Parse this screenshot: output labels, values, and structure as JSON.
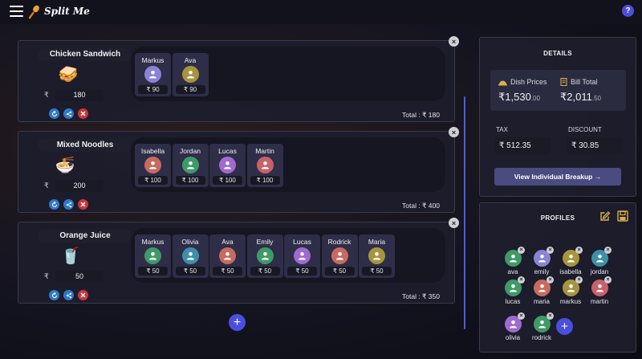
{
  "app": {
    "title": "Split Me",
    "help_label": "?"
  },
  "currency": "₹",
  "dishes": [
    {
      "name": "Chicken Sandwich",
      "emoji": "🥪",
      "price": "180",
      "total": "Total :  ₹ 180",
      "shares": [
        {
          "name": "Markus",
          "amount": "₹ 90",
          "color": "#8a83d6"
        },
        {
          "name": "Ava",
          "amount": "₹ 90",
          "color": "#a8943f"
        }
      ]
    },
    {
      "name": "Mixed Noodles",
      "emoji": "🍜",
      "price": "200",
      "total": "Total :  ₹ 400",
      "shares": [
        {
          "name": "Isabella",
          "amount": "₹ 100",
          "color": "#c86a5e"
        },
        {
          "name": "Jordan",
          "amount": "₹ 100",
          "color": "#3f9a66"
        },
        {
          "name": "Lucas",
          "amount": "₹ 100",
          "color": "#a06ad0"
        },
        {
          "name": "Martin",
          "amount": "₹ 100",
          "color": "#c8606a"
        }
      ]
    },
    {
      "name": "Orange Juice",
      "emoji": "🥤",
      "price": "50",
      "total": "Total :  ₹ 350",
      "shares": [
        {
          "name": "Markus",
          "amount": "₹ 50",
          "color": "#3f9a66"
        },
        {
          "name": "Olivia",
          "amount": "₹ 50",
          "color": "#3e8fa8"
        },
        {
          "name": "Ava",
          "amount": "₹ 50",
          "color": "#c86a5e"
        },
        {
          "name": "Emily",
          "amount": "₹ 50",
          "color": "#3f9a66"
        },
        {
          "name": "Lucas",
          "amount": "₹ 50",
          "color": "#a06ad0"
        },
        {
          "name": "Rodrick",
          "amount": "₹ 50",
          "color": "#c86a5e"
        },
        {
          "name": "Maria",
          "amount": "₹ 50",
          "color": "#a8943f"
        }
      ]
    }
  ],
  "details": {
    "title": "DETAILS",
    "dish_prices_label": "Dish Prices",
    "dish_prices_main": "₹1,530",
    "dish_prices_dec": ".00",
    "bill_total_label": "Bill Total",
    "bill_total_main": "₹2,011",
    "bill_total_dec": ".50",
    "tax_label": "TAX",
    "tax_value": "₹ 512.35",
    "discount_label": "DISCOUNT",
    "discount_value": "₹ 30.85",
    "breakup_label": "View Individual Breakup  →"
  },
  "profiles": {
    "title": "PROFILES",
    "list": [
      {
        "name": "ava",
        "color": "#3f9a66"
      },
      {
        "name": "emily",
        "color": "#8a83d6"
      },
      {
        "name": "isabella",
        "color": "#a8943f"
      },
      {
        "name": "jordan",
        "color": "#3e8fa8"
      },
      {
        "name": "lucas",
        "color": "#3f9a66"
      },
      {
        "name": "maria",
        "color": "#c86a5e"
      },
      {
        "name": "markus",
        "color": "#a8943f"
      },
      {
        "name": "martin",
        "color": "#c8606a"
      },
      {
        "name": "olivia",
        "color": "#a06ad0"
      },
      {
        "name": "rodrick",
        "color": "#3f9a66"
      }
    ]
  },
  "icons": {
    "menu": "hamburger-icon",
    "logo": "spoon-logo-icon",
    "reset": "reset-icon",
    "share": "share-icon",
    "delete": "delete-icon",
    "user": "user-icon",
    "dish_prices": "dish-icon",
    "bill_total": "receipt-icon",
    "edit": "edit-icon",
    "save": "save-icon",
    "add": "plus-icon"
  }
}
